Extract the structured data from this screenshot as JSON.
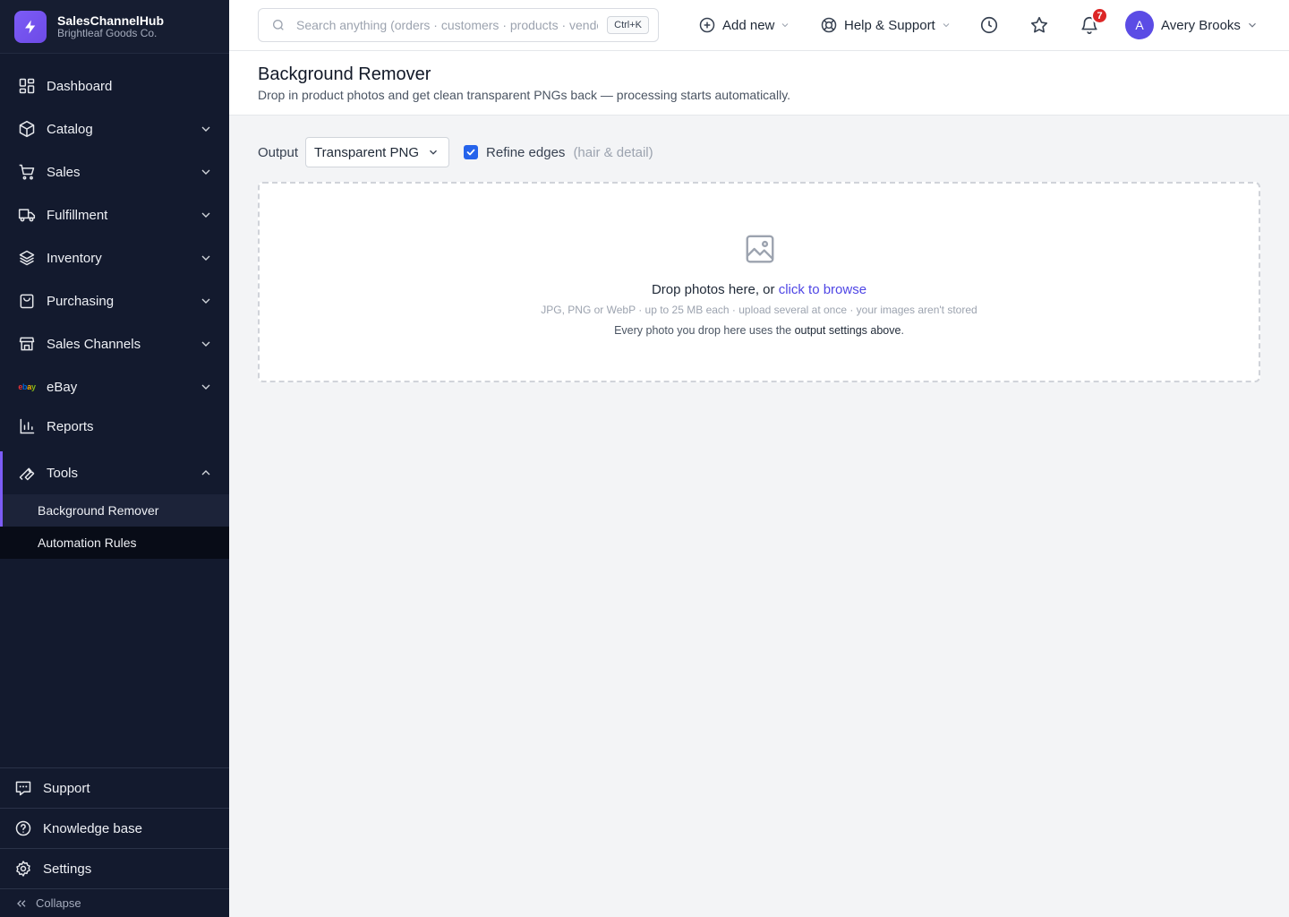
{
  "brand": {
    "name": "SalesChannelHub",
    "org": "Brightleaf Goods Co."
  },
  "sidebar": {
    "items": [
      {
        "label": "Dashboard",
        "icon": "dashboard-icon"
      },
      {
        "label": "Catalog",
        "icon": "box-icon"
      },
      {
        "label": "Sales",
        "icon": "cart-icon"
      },
      {
        "label": "Fulfillment",
        "icon": "truck-icon"
      },
      {
        "label": "Inventory",
        "icon": "layers-icon"
      },
      {
        "label": "Purchasing",
        "icon": "bag-icon"
      },
      {
        "label": "Sales Channels",
        "icon": "store-icon"
      },
      {
        "label": "eBay",
        "icon": "ebay-logo"
      },
      {
        "label": "Reports",
        "icon": "bar-chart-icon"
      },
      {
        "label": "Tools",
        "icon": "wrench-icon"
      }
    ],
    "ebay_logo": {
      "e": "e",
      "b": "b",
      "a": "a",
      "y": "y"
    },
    "tools_sub": [
      "Background Remover",
      "Automation Rules"
    ],
    "bottom": [
      "Support",
      "Knowledge base",
      "Settings"
    ],
    "collapse": "Collapse"
  },
  "topbar": {
    "search_placeholder": "Search anything (orders · customers · products · vendors)",
    "shortcut": "Ctrl+K",
    "add_new": "Add new",
    "help": "Help & Support",
    "notifications_count": "7",
    "user": {
      "initial": "A",
      "name": "Avery Brooks"
    }
  },
  "page": {
    "title": "Background Remover",
    "subtitle": "Drop in product photos and get clean transparent PNGs back — processing starts automatically."
  },
  "controls": {
    "output_label": "Output",
    "output_value": "Transparent PNG",
    "refine_label": "Refine edges",
    "refine_hint": "(hair & detail)",
    "refine_checked": true
  },
  "dropzone": {
    "main_text": "Drop photos here, or ",
    "link_text": "click to browse",
    "formats": "JPG, PNG or WebP · up to 25 MB each · upload several at once · your images aren't stored",
    "note_prefix": "Every photo you drop here uses the ",
    "note_strong": "output settings above",
    "note_suffix": "."
  },
  "colors": {
    "accent": "#7c5cf6",
    "sidebar_bg": "#131a2e",
    "link": "#4f46e5",
    "badge": "#dc2626",
    "checkbox": "#2563eb"
  }
}
